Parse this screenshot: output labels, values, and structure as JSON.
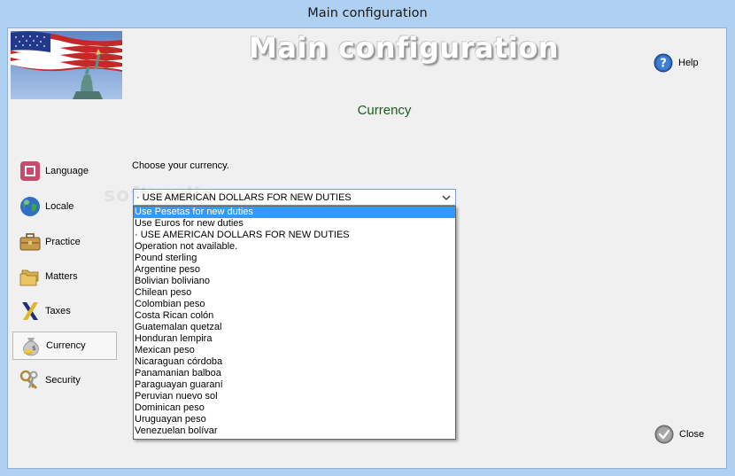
{
  "window": {
    "title": "Main configuration"
  },
  "header": {
    "big_title": "Main configuration",
    "section_title": "Currency"
  },
  "help": {
    "label": "Help"
  },
  "close": {
    "label": "Close"
  },
  "nav": {
    "items": [
      {
        "label": "Language",
        "icon": "language-icon"
      },
      {
        "label": "Locale",
        "icon": "globe-icon"
      },
      {
        "label": "Practice",
        "icon": "briefcase-icon"
      },
      {
        "label": "Matters",
        "icon": "folders-icon"
      },
      {
        "label": "Taxes",
        "icon": "taxes-icon"
      },
      {
        "label": "Currency",
        "icon": "money-bag-icon",
        "selected": true
      },
      {
        "label": "Security",
        "icon": "keys-icon"
      }
    ]
  },
  "currency": {
    "prompt": "Choose your currency.",
    "selected": "· USE AMERICAN DOLLARS FOR NEW DUTIES",
    "highlighted_index": 0,
    "options": [
      "Use Pesetas for new duties",
      "Use Euros for new duties",
      "· USE AMERICAN DOLLARS FOR NEW DUTIES",
      "Operation not available.",
      "Pound sterling",
      "Argentine peso",
      "Bolivian boliviano",
      "Chilean peso",
      "Colombian peso",
      "Costa Rican colón",
      "Guatemalan quetzal",
      "Honduran lempira",
      "Mexican peso",
      "Nicaraguan córdoba",
      "Panamanian balboa",
      "Paraguayan guaraní",
      "Peruvian nuevo sol",
      "Dominican peso",
      "Uruguayan peso",
      "Venezuelan bolívar"
    ]
  },
  "watermark": "softpedia",
  "colors": {
    "highlight": "#3399ff",
    "section_title": "#1c5c1c",
    "frame": "#aed1f1"
  }
}
